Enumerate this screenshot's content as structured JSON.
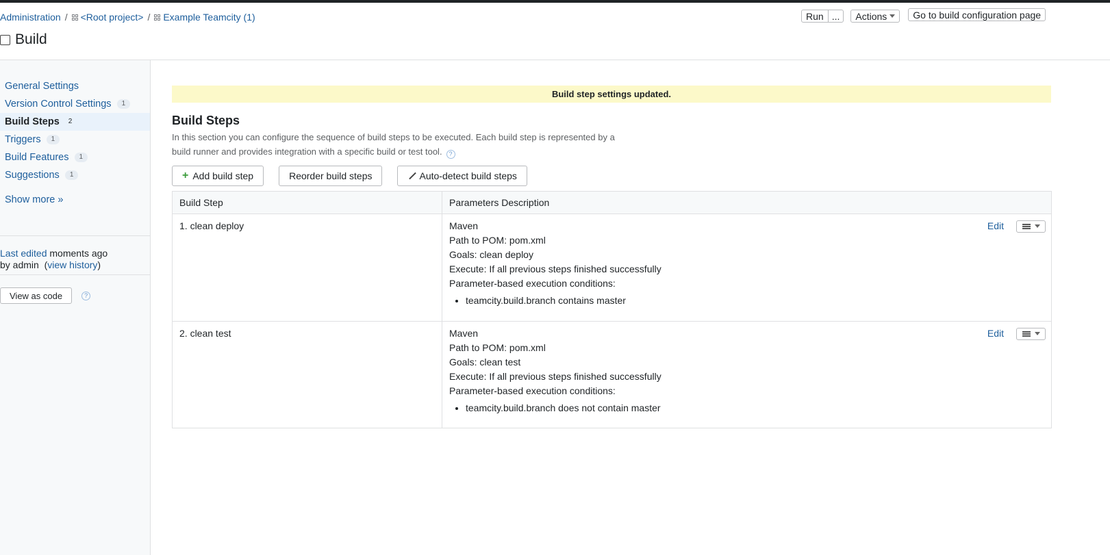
{
  "breadcrumbs": [
    {
      "label": "Administration"
    },
    {
      "label": "<Root project>"
    },
    {
      "label": "Example Teamcity (1)"
    }
  ],
  "page": {
    "title": "Build"
  },
  "top_actions": {
    "run_label": "Run",
    "run_more_label": "...",
    "actions_label": "Actions",
    "go_to_config_label": "Go to build configuration page"
  },
  "sidebar": {
    "items": [
      {
        "label": "General Settings",
        "count": ""
      },
      {
        "label": "Version Control Settings",
        "count": "1"
      },
      {
        "label": "Build Steps",
        "count": "2",
        "active": true
      },
      {
        "label": "Triggers",
        "count": "1"
      },
      {
        "label": "Build Features",
        "count": "1"
      },
      {
        "label": "Suggestions",
        "count": "1"
      }
    ],
    "show_more": "Show more »",
    "last_edited_link": "Last edited",
    "last_edited_time": " moments ago",
    "by_user": "by admin",
    "view_history": "view history",
    "view_as_code": "View as code"
  },
  "main": {
    "notice": "Build step settings updated.",
    "section_title": "Build Steps",
    "description": "In this section you can configure the sequence of build steps to be executed. Each build step is represented by a build runner and provides integration with a specific build or test tool.",
    "buttons": {
      "add": "Add build step",
      "reorder": "Reorder build steps",
      "autodetect": "Auto-detect build steps"
    },
    "table": {
      "headers": [
        "Build Step",
        "Parameters Description"
      ],
      "edit_label": "Edit",
      "rows": [
        {
          "name": "1. clean deploy",
          "runner": "Maven",
          "pom": "Path to POM: pom.xml",
          "goals": "Goals: clean deploy",
          "execute": "Execute: If all previous steps finished successfully",
          "conditions_label": "Parameter-based execution conditions:",
          "condition": "teamcity.build.branch contains master"
        },
        {
          "name": "2. clean test",
          "runner": "Maven",
          "pom": "Path to POM: pom.xml",
          "goals": "Goals: clean test",
          "execute": "Execute: If all previous steps finished successfully",
          "conditions_label": "Parameter-based execution conditions:",
          "condition": "teamcity.build.branch does not contain master"
        }
      ]
    }
  }
}
